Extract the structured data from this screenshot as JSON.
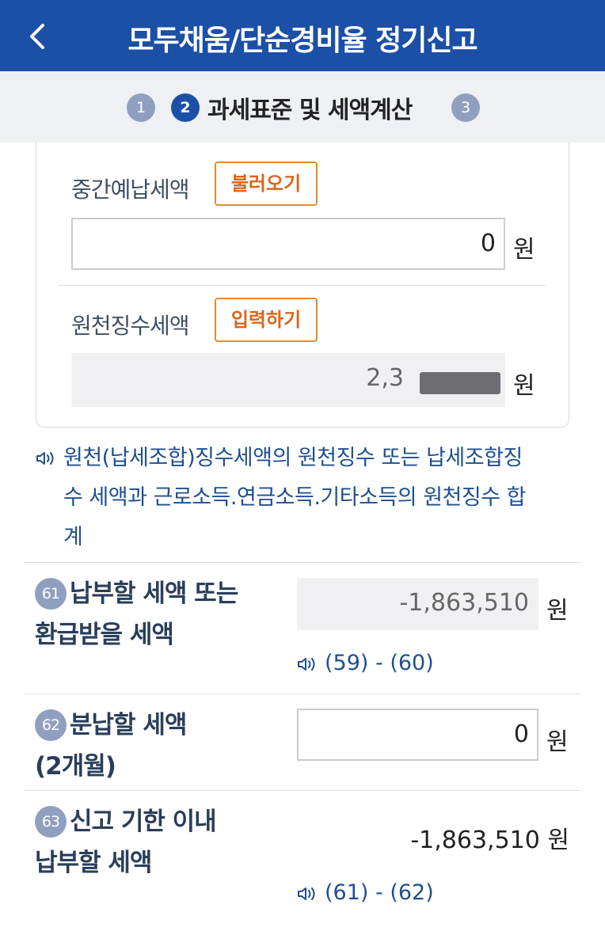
{
  "header": {
    "title": "모두채움/단순경비율 정기신고"
  },
  "steps": {
    "step1": "1",
    "step2": "2",
    "step2_label": "과세표준 및 세액계산",
    "step3": "3"
  },
  "interim_tax": {
    "label": "중간예납세액",
    "button": "불러오기",
    "value": "0",
    "unit": "원"
  },
  "withholding_tax": {
    "label": "원천징수세액",
    "button": "입력하기",
    "value": "2,3",
    "unit": "원"
  },
  "note": {
    "icon": "speaker-icon",
    "lines": [
      "원천(납세조합)징수세액의 원천징수 또는 납세조합징",
      "수 세액과 근로소득.연금소득.기타소득의 원천징수 합",
      "계"
    ]
  },
  "row61": {
    "number": "61",
    "label_line1": "납부할 세액 또는",
    "label_line2": "환급받을 세액",
    "value": "-1,863,510",
    "unit": "원",
    "formula": "(59) - (60)"
  },
  "row62": {
    "number": "62",
    "label_line1": "분납할 세액",
    "label_line2": "(2개월)",
    "value": "0",
    "unit": "원"
  },
  "row63": {
    "number": "63",
    "label_line1": "신고 기한 이내",
    "label_line2": "납부할 세액",
    "value": "-1,863,510 원",
    "formula": "(61) - (62)"
  },
  "colors": {
    "header": "#1c4fa6",
    "accent_orange": "#e58a2e",
    "note_blue": "#1f4f8f"
  }
}
